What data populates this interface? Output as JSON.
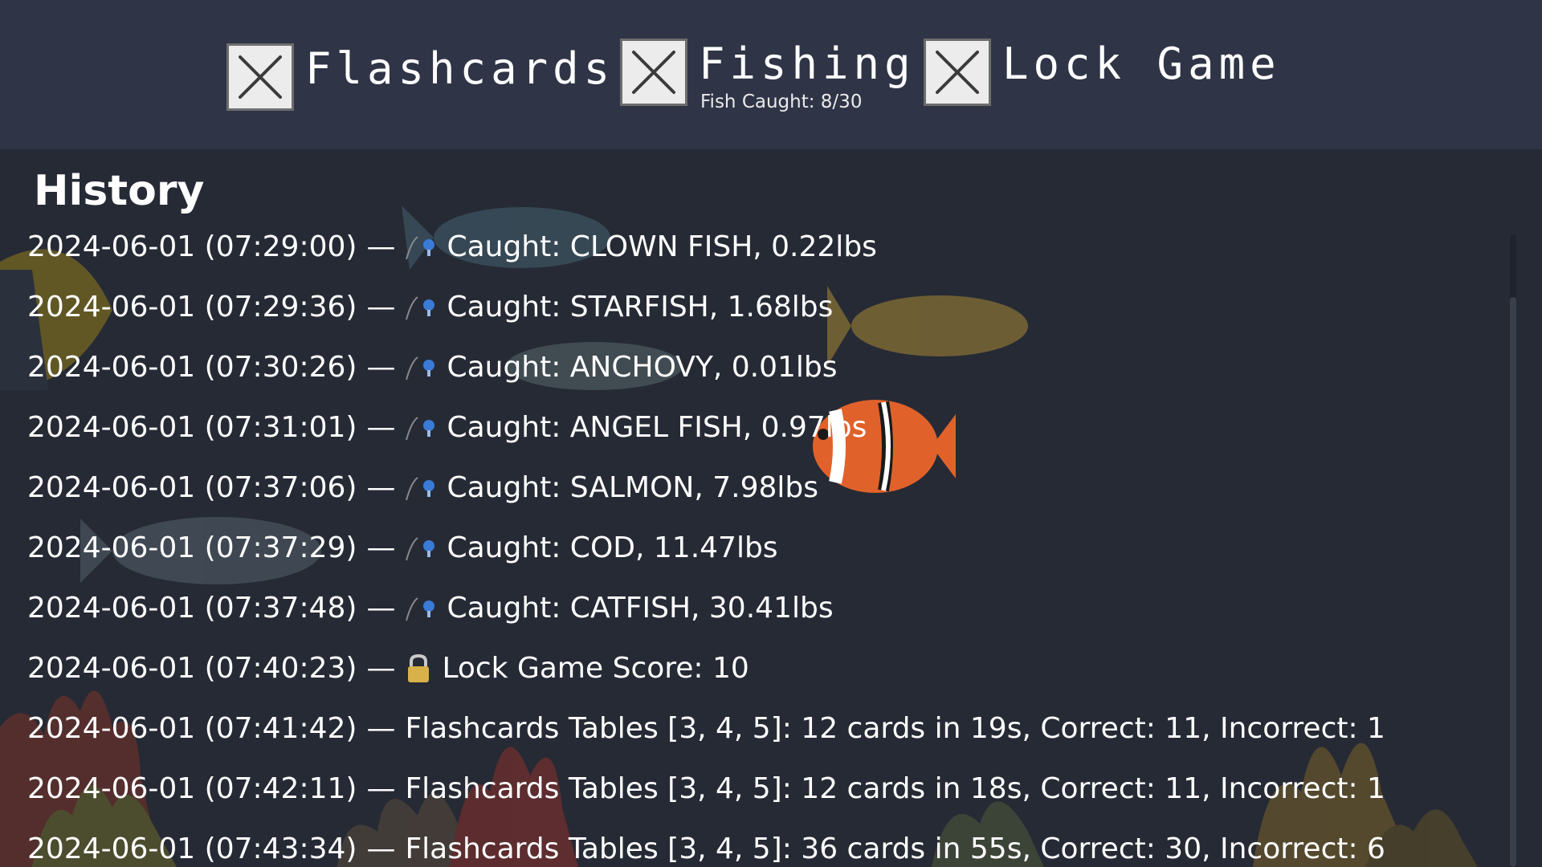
{
  "nav": {
    "flashcards": {
      "label": "Flashcards",
      "icon": "close-icon"
    },
    "fishing": {
      "label": "Fishing",
      "subtitle": "Fish Caught: 8/30",
      "icon": "close-icon"
    },
    "lock_game": {
      "label": "Lock Game",
      "icon": "close-icon"
    }
  },
  "history": {
    "title": "History",
    "separator": "—",
    "entries": [
      {
        "timestamp": "2024-06-01 (07:29:00)",
        "icon": "fishing-rod-icon",
        "text": "Caught: CLOWN FISH, 0.22lbs"
      },
      {
        "timestamp": "2024-06-01 (07:29:36)",
        "icon": "fishing-rod-icon",
        "text": "Caught: STARFISH, 1.68lbs"
      },
      {
        "timestamp": "2024-06-01 (07:30:26)",
        "icon": "fishing-rod-icon",
        "text": "Caught: ANCHOVY, 0.01lbs"
      },
      {
        "timestamp": "2024-06-01 (07:31:01)",
        "icon": "fishing-rod-icon",
        "text": "Caught: ANGEL FISH, 0.97lbs"
      },
      {
        "timestamp": "2024-06-01 (07:37:06)",
        "icon": "fishing-rod-icon",
        "text": "Caught: SALMON, 7.98lbs"
      },
      {
        "timestamp": "2024-06-01 (07:37:29)",
        "icon": "fishing-rod-icon",
        "text": "Caught: COD, 11.47lbs"
      },
      {
        "timestamp": "2024-06-01 (07:37:48)",
        "icon": "fishing-rod-icon",
        "text": "Caught: CATFISH, 30.41lbs"
      },
      {
        "timestamp": "2024-06-01 (07:40:23)",
        "icon": "padlock-icon",
        "text": "Lock Game Score: 10"
      },
      {
        "timestamp": "2024-06-01 (07:41:42)",
        "icon": "",
        "text": "Flashcards Tables [3, 4, 5]: 12 cards in 19s, Correct: 11, Incorrect: 1"
      },
      {
        "timestamp": "2024-06-01 (07:42:11)",
        "icon": "",
        "text": "Flashcards Tables [3, 4, 5]: 12 cards in 18s, Correct: 11, Incorrect: 1"
      },
      {
        "timestamp": "2024-06-01 (07:43:34)",
        "icon": "",
        "text": "Flashcards Tables [3, 4, 5]: 36 cards in 55s, Correct: 30, Incorrect: 6"
      }
    ]
  },
  "colors": {
    "topbar_bg": "#2f3546",
    "content_bg": "#262a35",
    "text": "#ffffff",
    "bobber_blue": "#3a7bd5",
    "padlock_gold": "#d8b14a"
  }
}
